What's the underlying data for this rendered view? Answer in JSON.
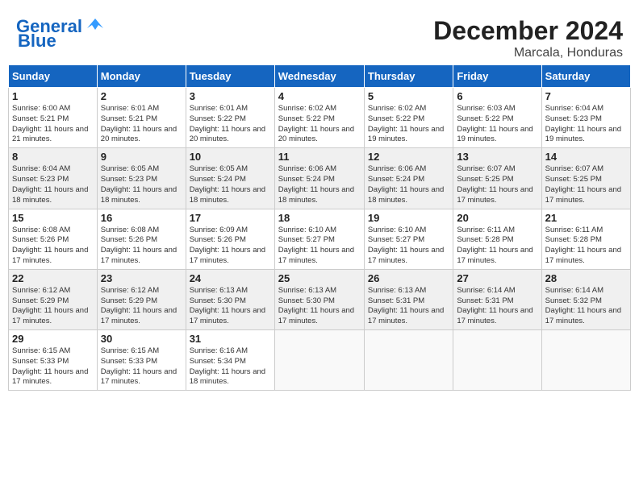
{
  "header": {
    "logo_line1": "General",
    "logo_line2": "Blue",
    "title": "December 2024",
    "subtitle": "Marcala, Honduras"
  },
  "weekdays": [
    "Sunday",
    "Monday",
    "Tuesday",
    "Wednesday",
    "Thursday",
    "Friday",
    "Saturday"
  ],
  "weeks": [
    [
      {
        "day": "1",
        "sunrise": "6:00 AM",
        "sunset": "5:21 PM",
        "daylight": "11 hours and 21 minutes."
      },
      {
        "day": "2",
        "sunrise": "6:01 AM",
        "sunset": "5:21 PM",
        "daylight": "11 hours and 20 minutes."
      },
      {
        "day": "3",
        "sunrise": "6:01 AM",
        "sunset": "5:22 PM",
        "daylight": "11 hours and 20 minutes."
      },
      {
        "day": "4",
        "sunrise": "6:02 AM",
        "sunset": "5:22 PM",
        "daylight": "11 hours and 20 minutes."
      },
      {
        "day": "5",
        "sunrise": "6:02 AM",
        "sunset": "5:22 PM",
        "daylight": "11 hours and 19 minutes."
      },
      {
        "day": "6",
        "sunrise": "6:03 AM",
        "sunset": "5:22 PM",
        "daylight": "11 hours and 19 minutes."
      },
      {
        "day": "7",
        "sunrise": "6:04 AM",
        "sunset": "5:23 PM",
        "daylight": "11 hours and 19 minutes."
      }
    ],
    [
      {
        "day": "8",
        "sunrise": "6:04 AM",
        "sunset": "5:23 PM",
        "daylight": "11 hours and 18 minutes."
      },
      {
        "day": "9",
        "sunrise": "6:05 AM",
        "sunset": "5:23 PM",
        "daylight": "11 hours and 18 minutes."
      },
      {
        "day": "10",
        "sunrise": "6:05 AM",
        "sunset": "5:24 PM",
        "daylight": "11 hours and 18 minutes."
      },
      {
        "day": "11",
        "sunrise": "6:06 AM",
        "sunset": "5:24 PM",
        "daylight": "11 hours and 18 minutes."
      },
      {
        "day": "12",
        "sunrise": "6:06 AM",
        "sunset": "5:24 PM",
        "daylight": "11 hours and 18 minutes."
      },
      {
        "day": "13",
        "sunrise": "6:07 AM",
        "sunset": "5:25 PM",
        "daylight": "11 hours and 17 minutes."
      },
      {
        "day": "14",
        "sunrise": "6:07 AM",
        "sunset": "5:25 PM",
        "daylight": "11 hours and 17 minutes."
      }
    ],
    [
      {
        "day": "15",
        "sunrise": "6:08 AM",
        "sunset": "5:26 PM",
        "daylight": "11 hours and 17 minutes."
      },
      {
        "day": "16",
        "sunrise": "6:08 AM",
        "sunset": "5:26 PM",
        "daylight": "11 hours and 17 minutes."
      },
      {
        "day": "17",
        "sunrise": "6:09 AM",
        "sunset": "5:26 PM",
        "daylight": "11 hours and 17 minutes."
      },
      {
        "day": "18",
        "sunrise": "6:10 AM",
        "sunset": "5:27 PM",
        "daylight": "11 hours and 17 minutes."
      },
      {
        "day": "19",
        "sunrise": "6:10 AM",
        "sunset": "5:27 PM",
        "daylight": "11 hours and 17 minutes."
      },
      {
        "day": "20",
        "sunrise": "6:11 AM",
        "sunset": "5:28 PM",
        "daylight": "11 hours and 17 minutes."
      },
      {
        "day": "21",
        "sunrise": "6:11 AM",
        "sunset": "5:28 PM",
        "daylight": "11 hours and 17 minutes."
      }
    ],
    [
      {
        "day": "22",
        "sunrise": "6:12 AM",
        "sunset": "5:29 PM",
        "daylight": "11 hours and 17 minutes."
      },
      {
        "day": "23",
        "sunrise": "6:12 AM",
        "sunset": "5:29 PM",
        "daylight": "11 hours and 17 minutes."
      },
      {
        "day": "24",
        "sunrise": "6:13 AM",
        "sunset": "5:30 PM",
        "daylight": "11 hours and 17 minutes."
      },
      {
        "day": "25",
        "sunrise": "6:13 AM",
        "sunset": "5:30 PM",
        "daylight": "11 hours and 17 minutes."
      },
      {
        "day": "26",
        "sunrise": "6:13 AM",
        "sunset": "5:31 PM",
        "daylight": "11 hours and 17 minutes."
      },
      {
        "day": "27",
        "sunrise": "6:14 AM",
        "sunset": "5:31 PM",
        "daylight": "11 hours and 17 minutes."
      },
      {
        "day": "28",
        "sunrise": "6:14 AM",
        "sunset": "5:32 PM",
        "daylight": "11 hours and 17 minutes."
      }
    ],
    [
      {
        "day": "29",
        "sunrise": "6:15 AM",
        "sunset": "5:33 PM",
        "daylight": "11 hours and 17 minutes."
      },
      {
        "day": "30",
        "sunrise": "6:15 AM",
        "sunset": "5:33 PM",
        "daylight": "11 hours and 17 minutes."
      },
      {
        "day": "31",
        "sunrise": "6:16 AM",
        "sunset": "5:34 PM",
        "daylight": "11 hours and 18 minutes."
      },
      null,
      null,
      null,
      null
    ]
  ]
}
